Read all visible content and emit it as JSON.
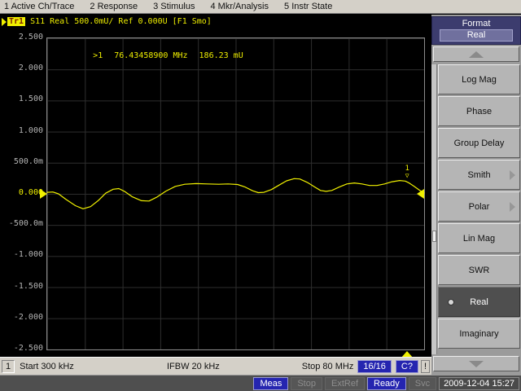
{
  "menu": {
    "items": [
      {
        "label": "1 Active Ch/Trace"
      },
      {
        "label": "2 Response"
      },
      {
        "label": "3 Stimulus"
      },
      {
        "label": "4 Mkr/Analysis"
      },
      {
        "label": "5 Instr State"
      }
    ]
  },
  "trace_header": {
    "trace": "Tr1",
    "text": "S11 Real 500.0mU/ Ref 0.000U [F1 Smo]"
  },
  "marker_readout": {
    "marker": ">1",
    "freq": "76.43458900 MHz",
    "value": "186.23 mU"
  },
  "chart_data": {
    "type": "line",
    "title": "S11 Real",
    "format": "Real",
    "scale_per_div": "500.0mU/",
    "ref_level": "0.000U",
    "divisions": 10,
    "ymax_mu": 2500,
    "ymin_mu": -2500,
    "y_ticks": [
      "2.500",
      "2.000",
      "1.500",
      "1.000",
      "500.0m",
      "0.000",
      "-500.0m",
      "-1.000",
      "-1.500",
      "-2.000",
      "-2.500"
    ],
    "x_start": "Start 300 kHz",
    "x_stop": "Stop 80 MHz",
    "ifbw": "IFBW 20 kHz",
    "grid": true,
    "marker": {
      "number": "1",
      "freq": "76.43458900 MHz",
      "value_mu": 186.23,
      "x_frac": 0.955
    },
    "trace": {
      "name": "Tr1 S11 Real (mU)",
      "color": "#f0f000",
      "points": [
        [
          0.0,
          25
        ],
        [
          0.015,
          30
        ],
        [
          0.03,
          0
        ],
        [
          0.05,
          -90
        ],
        [
          0.075,
          -190
        ],
        [
          0.095,
          -240
        ],
        [
          0.115,
          -205
        ],
        [
          0.135,
          -110
        ],
        [
          0.155,
          10
        ],
        [
          0.175,
          75
        ],
        [
          0.19,
          85
        ],
        [
          0.205,
          40
        ],
        [
          0.225,
          -45
        ],
        [
          0.25,
          -110
        ],
        [
          0.27,
          -115
        ],
        [
          0.29,
          -55
        ],
        [
          0.315,
          45
        ],
        [
          0.34,
          120
        ],
        [
          0.365,
          155
        ],
        [
          0.395,
          165
        ],
        [
          0.425,
          160
        ],
        [
          0.455,
          155
        ],
        [
          0.48,
          160
        ],
        [
          0.505,
          150
        ],
        [
          0.525,
          110
        ],
        [
          0.545,
          50
        ],
        [
          0.56,
          20
        ],
        [
          0.575,
          25
        ],
        [
          0.595,
          70
        ],
        [
          0.615,
          140
        ],
        [
          0.635,
          210
        ],
        [
          0.655,
          245
        ],
        [
          0.67,
          240
        ],
        [
          0.69,
          185
        ],
        [
          0.71,
          110
        ],
        [
          0.725,
          55
        ],
        [
          0.74,
          40
        ],
        [
          0.755,
          55
        ],
        [
          0.775,
          110
        ],
        [
          0.795,
          160
        ],
        [
          0.815,
          175
        ],
        [
          0.835,
          160
        ],
        [
          0.855,
          135
        ],
        [
          0.875,
          135
        ],
        [
          0.895,
          160
        ],
        [
          0.915,
          195
        ],
        [
          0.935,
          215
        ],
        [
          0.95,
          205
        ],
        [
          0.96,
          175
        ],
        [
          0.975,
          115
        ],
        [
          0.99,
          50
        ],
        [
          1.0,
          15
        ]
      ]
    }
  },
  "channel_bar": {
    "channel": "1",
    "start": "Start 300 kHz",
    "ifbw": "IFBW 20 kHz",
    "stop": "Stop 80 MHz",
    "badges": [
      {
        "label": "16/16"
      },
      {
        "label": "C?"
      },
      {
        "label": "!"
      }
    ]
  },
  "sidebar": {
    "title": "Format",
    "value": "Real",
    "buttons": [
      {
        "label": "Log Mag",
        "selected": false,
        "submenu": false
      },
      {
        "label": "Phase",
        "selected": false,
        "submenu": false
      },
      {
        "label": "Group Delay",
        "selected": false,
        "submenu": false
      },
      {
        "label": "Smith",
        "selected": false,
        "submenu": true
      },
      {
        "label": "Polar",
        "selected": false,
        "submenu": true
      },
      {
        "label": "Lin Mag",
        "selected": false,
        "submenu": false
      },
      {
        "label": "SWR",
        "selected": false,
        "submenu": false
      },
      {
        "label": "Real",
        "selected": true,
        "submenu": false
      },
      {
        "label": "Imaginary",
        "selected": false,
        "submenu": false
      }
    ]
  },
  "status_bar": {
    "items": [
      {
        "label": "Meas",
        "active": true
      },
      {
        "label": "Stop",
        "active": false
      },
      {
        "label": "ExtRef",
        "active": false
      },
      {
        "label": "Ready",
        "active": true
      },
      {
        "label": "Svc",
        "active": false
      }
    ],
    "datetime": "2009-12-04 15:27"
  },
  "colors": {
    "trace_yellow": "#f0f000",
    "grid": "#2e2e2e",
    "plot_bg": "#000000",
    "menubar_bg": "#d4d0c8",
    "active_blue": "#2525b0",
    "sidebar_header": "#3c3c6e",
    "softkey_bg": "#b5b5b5",
    "softkey_selected": "#4f4f4f",
    "statusbar_bg": "#4f4f4f"
  }
}
